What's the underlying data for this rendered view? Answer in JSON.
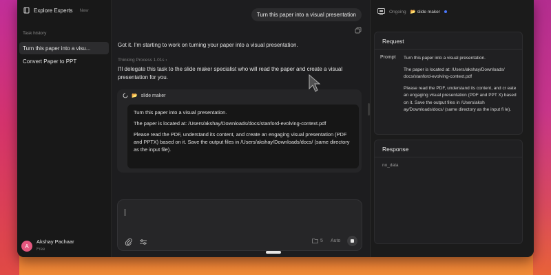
{
  "sidebar": {
    "brand": "Explore Experts",
    "brand_badge": "New",
    "section_label": "Task history",
    "tasks": [
      {
        "label": "Turn this paper into a visu..."
      },
      {
        "label": "Convert Paper to PPT"
      }
    ],
    "user": {
      "initial": "A",
      "name": "Akshay Pachaar",
      "plan": "Free"
    }
  },
  "chat": {
    "user_message": "Turn this paper into a visual presentation",
    "assistant_intro": "Got it. I'm starting to work on turning your paper into a visual presentation.",
    "thinking": "Thinking Process  1.01s  ›",
    "delegate": "I'll delegate this task to the slide maker specialist who will read the paper and create a visual presentation for you.",
    "subtask": {
      "agent": "slide maker",
      "lines": [
        "Turn this paper into a visual presentation.",
        "The paper is located at: /Users/akshay/Downloads/docs/stanford-evolving-context.pdf",
        "Please read the PDF, understand its content, and create an engaging visual presentation (PDF and PPTX) based on it. Save the output files in /Users/akshay/Downloads/docs/ (same directory as the input file)."
      ]
    },
    "composer": {
      "file_count": "5",
      "mode": "Auto"
    }
  },
  "panel": {
    "status": "Ongoing",
    "agent": "slide maker",
    "request_title": "Request",
    "prompt_label": "Prompt",
    "prompt_lines": [
      "Turn this paper into a visual presentation.",
      "The paper is located at: /Users/akshay/Downloads/ docs/stanford-evolving-context.pdf",
      "Please read the PDF, understand its content, and cr eate an engaging visual presentation (PDF and PPT X) based on it. Save the output files in /Users/aksh ay/Downloads/docs/ (same directory as the input fi le)."
    ],
    "response_title": "Response",
    "response_value": "no_data"
  },
  "colors": {
    "accent_dot": "#4a78ff",
    "avatar": "#e4577f",
    "window_bg": "#1d1d1f"
  }
}
